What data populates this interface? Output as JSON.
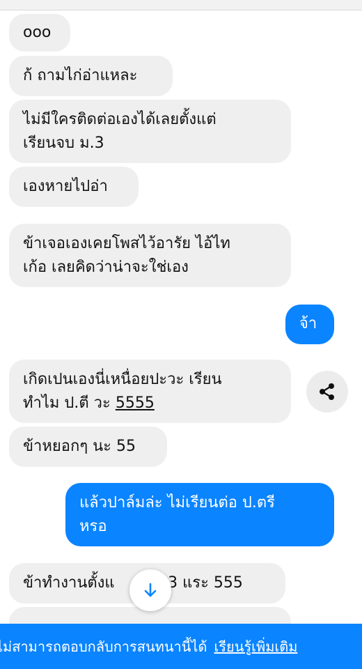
{
  "messages": [
    {
      "text": "ooo"
    },
    {
      "text": "ก้ ถามไก่อ่าแหละ"
    },
    {
      "line1": "ไม่มีใครติดต่อเองได้เลยตั้งแต่",
      "line2": "เรียนจบ ม.3"
    },
    {
      "text": "เองหายไปอ่า"
    },
    {
      "line1": "ข้าเจอเองเคยโพสไว้อารัย ไอ้ไท",
      "line2": "เก้อ เลยคิดว่าน่าจะใช่เอง"
    },
    {
      "text": "จ้า"
    },
    {
      "line1": "เกิดเปนเองนี่เหนื่อยปะวะ เรียน",
      "line2a": "ทำไม ป.ตี วะ ",
      "line2b": "5555"
    },
    {
      "text": "ข้าหยอกๆ นะ 55"
    },
    {
      "line1": "แล้วปาล์มล่ะ ไม่เรียนต่อ ป.ตรี",
      "line2": "หรอ"
    },
    {
      "part1": "ข้าทำงานตั้งแ",
      "part2": "ม. 3 แระ 555"
    }
  ],
  "footer": {
    "text": "ไม่สามารถตอบกลับการสนทนานี้ได้",
    "link": "เรียนรู้เพิ่มเติม"
  },
  "colors": {
    "accent": "#0a84ff",
    "incoming": "#efefef"
  },
  "icons": {
    "share": "share-icon",
    "scroll": "arrow-down-icon"
  }
}
